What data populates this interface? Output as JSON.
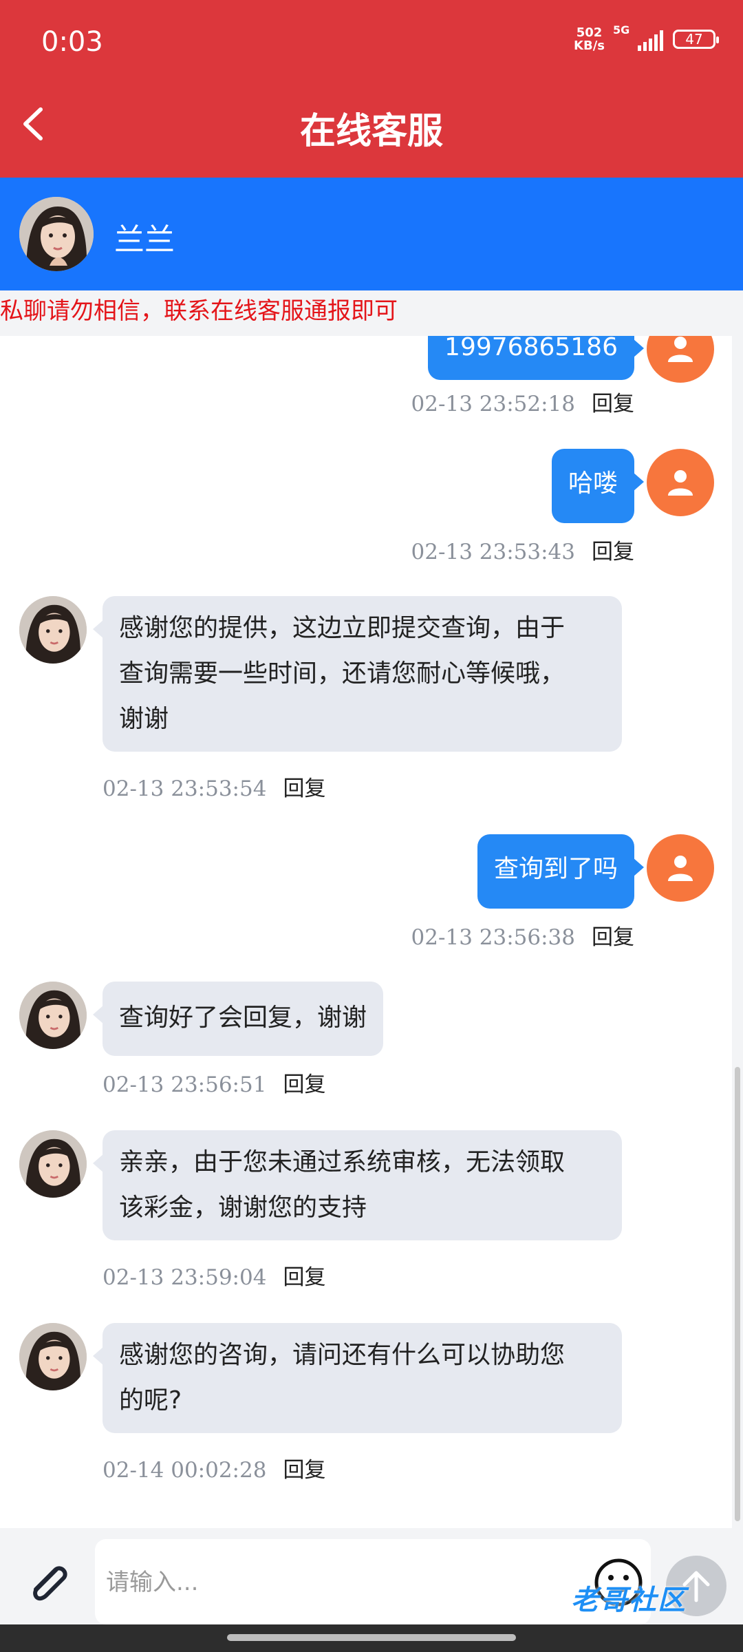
{
  "status_bar": {
    "time": "0:03",
    "speed_value": "502",
    "speed_unit": "KB/s",
    "network": "5G",
    "battery": "47"
  },
  "header": {
    "title": "在线客服"
  },
  "agent": {
    "name": "兰兰"
  },
  "warning": "私聊请勿相信，联系在线客服通报即可",
  "reply_label": "回复",
  "messages": [
    {
      "side": "me",
      "text": "19976865186",
      "time": "02-13 23:52:18"
    },
    {
      "side": "me",
      "text": "哈喽",
      "time": "02-13 23:53:43"
    },
    {
      "side": "agent",
      "line1": "感谢您的提供，这边立即提交查询，由于",
      "line2": "查询需要一些时间，还请您耐心等候哦，",
      "line3": "谢谢",
      "time": "02-13 23:53:54"
    },
    {
      "side": "me",
      "text": "查询到了吗",
      "time": "02-13 23:56:38"
    },
    {
      "side": "agent",
      "text": "查询好了会回复，谢谢",
      "time": "02-13 23:56:51"
    },
    {
      "side": "agent",
      "line1": "亲亲，由于您未通过系统审核，无法领取",
      "line2": "该彩金，谢谢您的支持",
      "time": "02-13 23:59:04"
    },
    {
      "side": "agent",
      "line1": "感谢您的咨询，请问还有什么可以协助您",
      "line2": "的呢?",
      "time": "02-14 00:02:28"
    }
  ],
  "input": {
    "placeholder": "请输入..."
  },
  "watermark": "老哥社区",
  "colors": {
    "header": "#dc373c",
    "agent_strip": "#1875fd",
    "user_bubble": "#2589f5",
    "agent_bubble": "#e6e9f0",
    "user_avatar": "#f7763d",
    "warning": "#e4151a"
  }
}
